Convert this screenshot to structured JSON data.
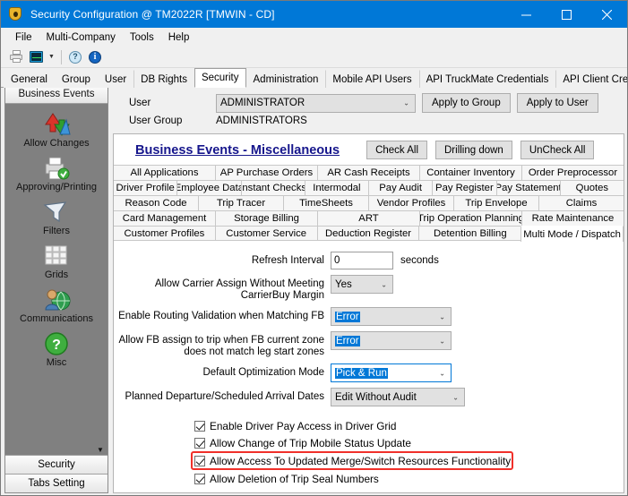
{
  "window": {
    "title": "Security Configuration @ TM2022R [TMWIN - CD]",
    "icon": "security-badge-icon",
    "accent_color": "#0078d7",
    "minimize_label": "Minimize",
    "maximize_label": "Maximize",
    "close_label": "Close"
  },
  "menubar": {
    "items": [
      {
        "label": "File"
      },
      {
        "label": "Multi-Company"
      },
      {
        "label": "Tools"
      },
      {
        "label": "Help"
      }
    ]
  },
  "toolbar": {
    "items": [
      {
        "name": "print-icon",
        "label": "Print"
      },
      {
        "name": "monitor-icon",
        "label": "Monitor"
      },
      {
        "name": "chevron-down-icon",
        "label": "More"
      },
      {
        "name": "help-icon",
        "label": "Help"
      },
      {
        "name": "info-icon",
        "label": "Info"
      }
    ]
  },
  "main_tabs": {
    "active": "Security",
    "items": [
      {
        "label": "General"
      },
      {
        "label": "Group"
      },
      {
        "label": "User"
      },
      {
        "label": "DB Rights"
      },
      {
        "label": "Security"
      },
      {
        "label": "Administration"
      },
      {
        "label": "Mobile API Users"
      },
      {
        "label": "API TruckMate Credentials"
      },
      {
        "label": "API Client Credentials"
      }
    ]
  },
  "sidebar": {
    "header": "Business Events",
    "items": [
      {
        "label": "Allow Changes",
        "icon": "allow-changes-icon"
      },
      {
        "label": "Approving/Printing",
        "icon": "approving-printing-icon"
      },
      {
        "label": "Filters",
        "icon": "filter-icon"
      },
      {
        "label": "Grids",
        "icon": "grid-icon"
      },
      {
        "label": "Communications",
        "icon": "communications-icon"
      },
      {
        "label": "Misc",
        "icon": "misc-question-icon"
      }
    ],
    "scroll_down_icon": "scroll-down-icon",
    "footers": [
      {
        "label": "Security"
      },
      {
        "label": "Tabs Setting"
      }
    ]
  },
  "form_header": {
    "user_label": "User",
    "user_value": "ADMINISTRATOR",
    "apply_to_group": "Apply to Group",
    "apply_to_user": "Apply to User",
    "user_group_label": "User Group",
    "user_group_value": "ADMINISTRATORS"
  },
  "panel": {
    "title": "Business Events - Miscellaneous",
    "check_all": "Check All",
    "drilling_down": "Drilling down",
    "uncheck_all": "UnCheck All"
  },
  "sub_tabs": {
    "active": "Multi Mode / Dispatch",
    "rows": [
      [
        "All Applications",
        "AP Purchase Orders",
        "AR Cash Receipts",
        "Container Inventory",
        "Order Preprocessor"
      ],
      [
        "Driver Profile",
        "Employee Data",
        "Instant Checks",
        "Intermodal",
        "Pay Audit",
        "Pay Register",
        "Pay Statement",
        "Quotes"
      ],
      [
        "Reason Code",
        "Trip Tracer",
        "TimeSheets",
        "Vendor Profiles",
        "Trip Envelope",
        "Claims"
      ],
      [
        "Card Management",
        "Storage Billing",
        "ART",
        "Trip Operation Planning",
        "Rate Maintenance"
      ],
      [
        "Customer Profiles",
        "Customer Service",
        "Deduction Register",
        "Detention Billing",
        "Multi Mode / Dispatch"
      ]
    ]
  },
  "fields": [
    {
      "label": "Refresh Interval",
      "type": "textbox",
      "value": "0",
      "unit": "seconds",
      "name": "refresh-interval-input"
    },
    {
      "label": "Allow Carrier Assign Without Meeting CarrierBuy Margin",
      "type": "combo",
      "value": "Yes",
      "name": "allow-carrier-assign-combo",
      "selected": false,
      "focused": false
    },
    {
      "label": "Enable Routing Validation when Matching FB",
      "type": "combo",
      "value": "Error",
      "name": "enable-routing-validation-combo",
      "selected": true,
      "focused": false
    },
    {
      "label": "Allow FB assign to trip when FB current zone does not match leg start zones",
      "type": "combo",
      "value": "Error",
      "name": "allow-fb-assign-combo",
      "selected": true,
      "focused": false
    },
    {
      "label": "Default Optimization Mode",
      "type": "combo",
      "value": "Pick & Run",
      "name": "default-optimization-mode-combo",
      "selected": true,
      "focused": true
    },
    {
      "label": "Planned Departure/Scheduled Arrival Dates",
      "type": "combo",
      "value": "Edit Without Audit",
      "name": "planned-departure-dates-combo",
      "selected": false,
      "focused": false
    }
  ],
  "checkboxes": [
    {
      "label": "Enable Driver Pay Access in Driver Grid",
      "checked": true,
      "highlighted": false,
      "name": "enable-driver-pay-access-checkbox"
    },
    {
      "label": "Allow Change of Trip Mobile Status Update",
      "checked": true,
      "highlighted": false,
      "name": "allow-change-trip-mobile-status-checkbox"
    },
    {
      "label": "Allow Access To Updated Merge/Switch Resources Functionality",
      "checked": true,
      "highlighted": true,
      "name": "allow-access-merge-switch-resources-checkbox"
    },
    {
      "label": "Allow Deletion of Trip Seal Numbers",
      "checked": true,
      "highlighted": false,
      "name": "allow-deletion-trip-seal-numbers-checkbox"
    }
  ],
  "highlight_color": "#f0302a"
}
